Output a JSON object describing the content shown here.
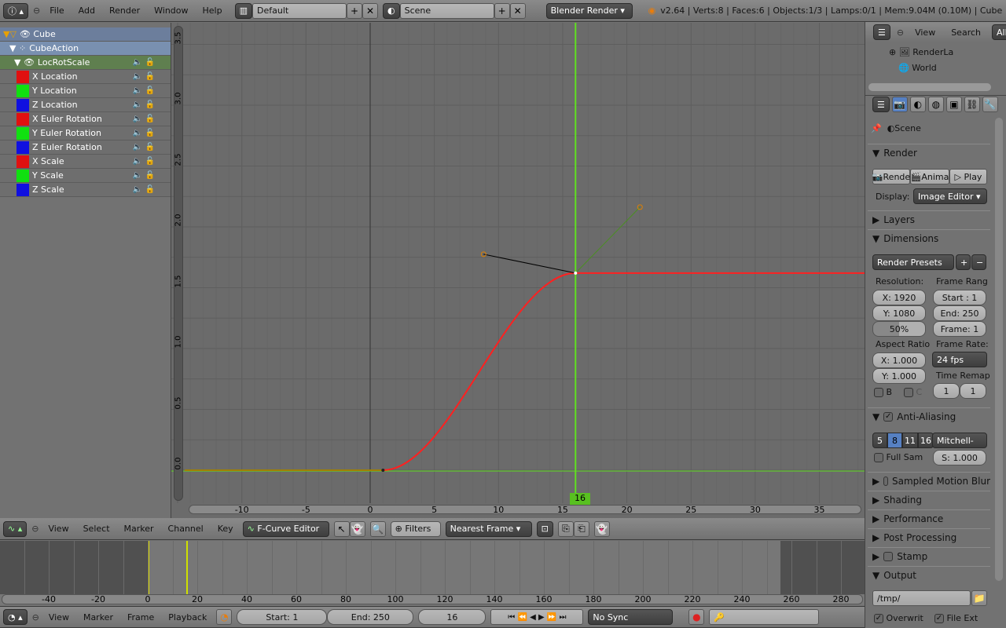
{
  "topbar": {
    "menus": [
      "File",
      "Add",
      "Render",
      "Window",
      "Help"
    ],
    "layout": "Default",
    "scene": "Scene",
    "engine": "Blender Render",
    "stats": "v2.64 | Verts:8 | Faces:6 | Objects:1/3 | Lamps:0/1 | Mem:9.04M (0.10M) | Cube"
  },
  "channels": {
    "object": "Cube",
    "action": "CubeAction",
    "group": "LocRotScale",
    "items": [
      {
        "label": "X Location",
        "color": "#e01010"
      },
      {
        "label": "Y Location",
        "color": "#10e010"
      },
      {
        "label": "Z Location",
        "color": "#1010e0"
      },
      {
        "label": "X Euler Rotation",
        "color": "#e01010"
      },
      {
        "label": "Y Euler Rotation",
        "color": "#10e010"
      },
      {
        "label": "Z Euler Rotation",
        "color": "#1010e0"
      },
      {
        "label": "X Scale",
        "color": "#e01010"
      },
      {
        "label": "Y Scale",
        "color": "#10e010"
      },
      {
        "label": "Z Scale",
        "color": "#1010e0"
      }
    ]
  },
  "graph": {
    "x_ticks": [
      "-10",
      "-5",
      "0",
      "5",
      "10",
      "15",
      "20",
      "25",
      "30",
      "35"
    ],
    "y_ticks": [
      "0.0",
      "0.5",
      "1.0",
      "1.5",
      "2.0",
      "2.5",
      "3.0",
      "3.5"
    ],
    "current_frame": "16",
    "keyframes": [
      {
        "frame": 1,
        "value": 0
      },
      {
        "frame": 16,
        "value": 1.62
      }
    ],
    "curve_color": "#ff2020",
    "cursor_color": "#60e020"
  },
  "graph_header": {
    "menus": [
      "View",
      "Select",
      "Marker",
      "Channel",
      "Key"
    ],
    "mode": "F-Curve Editor",
    "filters": "Filters",
    "snap": "Nearest Frame"
  },
  "timeline": {
    "ticks": [
      "-40",
      "-20",
      "0",
      "20",
      "40",
      "60",
      "80",
      "100",
      "120",
      "140",
      "160",
      "180",
      "200",
      "220",
      "240",
      "260",
      "280"
    ]
  },
  "timeline_header": {
    "menus": [
      "View",
      "Marker",
      "Frame",
      "Playback"
    ],
    "start": "Start: 1",
    "end": "End: 250",
    "frame": "16",
    "sync": "No Sync"
  },
  "outliner": {
    "menus": [
      "View",
      "Search"
    ],
    "filter": "All",
    "items": [
      "RenderLa",
      "World"
    ]
  },
  "props": {
    "context": "Scene",
    "render_panel": "Render",
    "render_btn": "Rende",
    "anim_btn": "Anima",
    "play_btn": "Play",
    "display_label": "Display:",
    "display_value": "Image Editor",
    "layers": "Layers",
    "dimensions": "Dimensions",
    "presets": "Render Presets",
    "resolution": "Resolution:",
    "res_x": "X: 1920",
    "res_y": "Y: 1080",
    "res_pct": "50%",
    "frame_range": "Frame Rang",
    "start": "Start : 1",
    "end": "End: 250",
    "frame": "Frame: 1",
    "aspect": "Aspect Ratio",
    "asp_x": "X: 1.000",
    "asp_y": "Y: 1.000",
    "frame_rate": "Frame Rate:",
    "fps": "24 fps",
    "time_remap": "Time Remap",
    "remap_old": "1",
    "remap_new": "1",
    "b": "B",
    "c": "C",
    "aa": "Anti-Aliasing",
    "aa_samples": [
      "5",
      "8",
      "11",
      "16"
    ],
    "aa_filter": "Mitchell-",
    "full_sample": "Full Sam",
    "filter_size": "S: 1.000",
    "panels": [
      "Sampled Motion Blur",
      "Shading",
      "Performance",
      "Post Processing",
      "Stamp",
      "Output"
    ],
    "output_path": "/tmp/",
    "overwrite": "Overwrit",
    "file_ext": "File Ext"
  }
}
